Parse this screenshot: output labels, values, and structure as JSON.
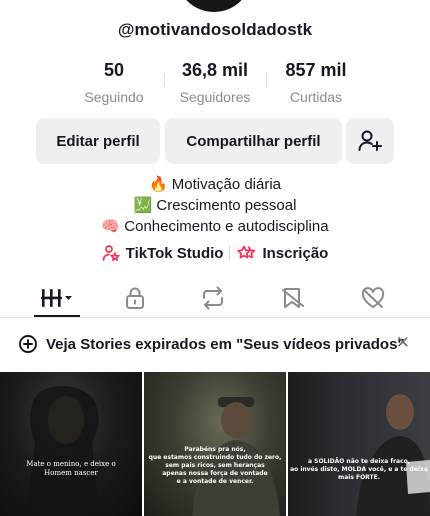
{
  "profile": {
    "username": "@motivandosoldadostk"
  },
  "stats": [
    {
      "value": "50",
      "label": "Seguindo"
    },
    {
      "value": "36,8 mil",
      "label": "Seguidores"
    },
    {
      "value": "857 mil",
      "label": "Curtidas"
    }
  ],
  "actions": {
    "edit_label": "Editar perfil",
    "share_label": "Compartilhar perfil",
    "add_friend_icon": "person-plus-icon"
  },
  "bio": [
    "🔥 Motivação diária",
    "💹 Crescimento pessoal",
    "🧠 Conhecimento e autodisciplina"
  ],
  "links": [
    {
      "label": "TikTok Studio",
      "icon": "studio-icon"
    },
    {
      "label": "Inscrição",
      "icon": "subscription-icon"
    }
  ],
  "tabs": [
    {
      "name": "videos",
      "icon": "grid-icon",
      "active": true
    },
    {
      "name": "private",
      "icon": "lock-icon"
    },
    {
      "name": "reposts",
      "icon": "repost-icon"
    },
    {
      "name": "favorites",
      "icon": "bookmark-icon"
    },
    {
      "name": "liked",
      "icon": "heart-hidden-icon"
    }
  ],
  "notice": {
    "text": "Veja Stories expirados em \"Seus vídeos privados\""
  },
  "videos": [
    {
      "caption": "Mate o menino, e deixe o\nHomem nascer"
    },
    {
      "caption": "Parabéns pra nós,\nque estamos construindo tudo do zero,\nsem pais ricos, sem heranças\napenas nossa força de vontade\ne a vontade de vencer."
    },
    {
      "caption": "a SOLIDÃO não te deixa fraco,\nao invés disto, MOLDA você, e a te deixa\nmais FORTE."
    }
  ],
  "colors": {
    "text": "#161823",
    "muted": "#8a8b91",
    "button_bg": "#efeff0",
    "accent_pink": "#fe2c55",
    "accent_cyan": "#20d5ec"
  }
}
